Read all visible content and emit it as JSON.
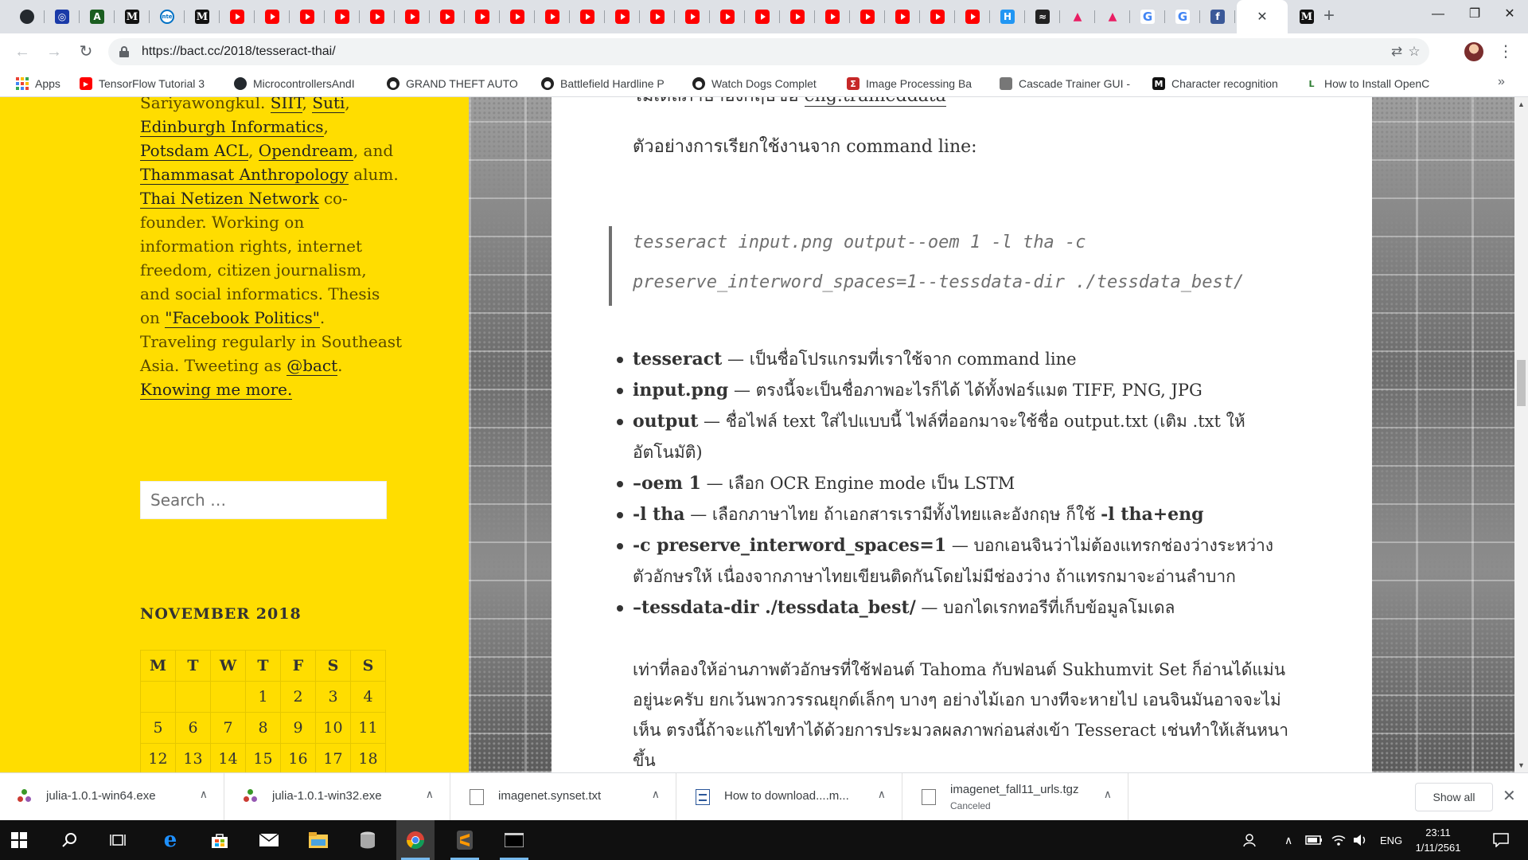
{
  "browser": {
    "tabs": [
      {
        "icon": "github-icon",
        "cls": "gh",
        "glyph": ""
      },
      {
        "icon": "blue-logo-icon",
        "cls": "blue",
        "glyph": "◎"
      },
      {
        "icon": "nvidia-icon",
        "cls": "nv",
        "glyph": "A"
      },
      {
        "icon": "medium-icon",
        "cls": "m",
        "glyph": "M"
      },
      {
        "icon": "intel-icon",
        "cls": "intel",
        "glyph": "intel"
      },
      {
        "icon": "medium-icon",
        "cls": "m",
        "glyph": "M"
      },
      {
        "icon": "youtube-icon",
        "cls": "yt",
        "glyph": ""
      },
      {
        "icon": "youtube-icon",
        "cls": "yt",
        "glyph": ""
      },
      {
        "icon": "youtube-icon",
        "cls": "yt",
        "glyph": ""
      },
      {
        "icon": "youtube-icon",
        "cls": "yt",
        "glyph": ""
      },
      {
        "icon": "youtube-icon",
        "cls": "yt",
        "glyph": ""
      },
      {
        "icon": "youtube-icon",
        "cls": "yt",
        "glyph": ""
      },
      {
        "icon": "youtube-icon",
        "cls": "yt",
        "glyph": ""
      },
      {
        "icon": "youtube-icon",
        "cls": "yt",
        "glyph": ""
      },
      {
        "icon": "youtube-icon",
        "cls": "yt",
        "glyph": ""
      },
      {
        "icon": "youtube-icon",
        "cls": "yt",
        "glyph": ""
      },
      {
        "icon": "youtube-icon",
        "cls": "yt",
        "glyph": ""
      },
      {
        "icon": "youtube-icon",
        "cls": "yt",
        "glyph": ""
      },
      {
        "icon": "youtube-icon",
        "cls": "yt",
        "glyph": ""
      },
      {
        "icon": "youtube-icon",
        "cls": "yt",
        "glyph": ""
      },
      {
        "icon": "youtube-icon",
        "cls": "yt",
        "glyph": ""
      },
      {
        "icon": "youtube-icon",
        "cls": "yt",
        "glyph": ""
      },
      {
        "icon": "youtube-icon",
        "cls": "yt",
        "glyph": ""
      },
      {
        "icon": "youtube-icon",
        "cls": "yt",
        "glyph": ""
      },
      {
        "icon": "youtube-icon",
        "cls": "yt",
        "glyph": ""
      },
      {
        "icon": "youtube-icon",
        "cls": "yt",
        "glyph": ""
      },
      {
        "icon": "youtube-icon",
        "cls": "yt",
        "glyph": ""
      },
      {
        "icon": "youtube-icon",
        "cls": "yt",
        "glyph": ""
      },
      {
        "icon": "hackernoon-icon",
        "cls": "h",
        "glyph": "H"
      },
      {
        "icon": "dark-site-icon",
        "cls": "dark",
        "glyph": "≈"
      },
      {
        "icon": "triangle-logo-icon",
        "cls": "tri",
        "glyph": "▲"
      },
      {
        "icon": "triangle-logo-icon",
        "cls": "tri",
        "glyph": "▲"
      },
      {
        "icon": "google-icon",
        "cls": "g",
        "glyph": "G"
      },
      {
        "icon": "google-icon",
        "cls": "g",
        "glyph": "G"
      },
      {
        "icon": "facebook-icon",
        "cls": "fb",
        "glyph": "f"
      }
    ],
    "active_tab_icon": "close-icon",
    "after_tab": {
      "icon": "medium-icon",
      "glyph": "M"
    },
    "url": "https://bact.cc/2018/tesseract-thai/"
  },
  "bookmarks": [
    {
      "label": "Apps",
      "icon": "apps-icon"
    },
    {
      "label": "TensorFlow Tutorial 3",
      "icon": "youtube-icon"
    },
    {
      "label": "MicrocontrollersAndI",
      "icon": "github-icon"
    },
    {
      "label": "GRAND THEFT AUTO",
      "icon": "game-icon"
    },
    {
      "label": "Battlefield Hardline P",
      "icon": "game-icon"
    },
    {
      "label": "Watch Dogs Complet",
      "icon": "game-icon"
    },
    {
      "label": "Image Processing Ba",
      "icon": "sigma-icon"
    },
    {
      "label": "Cascade Trainer GUI -",
      "icon": "app-icon"
    },
    {
      "label": "Character recognition",
      "icon": "medium-icon"
    },
    {
      "label": "How to Install OpenC",
      "icon": "l2c-icon"
    }
  ],
  "sidebar": {
    "bio_lines": [
      {
        "parts": [
          {
            "t": "Sariyawongkul. ",
            "l": false
          },
          {
            "t": "SIIT",
            "l": true
          },
          {
            "t": ", ",
            "l": false
          },
          {
            "t": "Suti",
            "l": true
          },
          {
            "t": ",",
            "l": false
          }
        ]
      },
      {
        "parts": [
          {
            "t": "Edinburgh Informatics",
            "l": true
          },
          {
            "t": ",",
            "l": false
          }
        ]
      },
      {
        "parts": [
          {
            "t": "Potsdam ACL",
            "l": true
          },
          {
            "t": ", ",
            "l": false
          },
          {
            "t": "Opendream",
            "l": true
          },
          {
            "t": ", and",
            "l": false
          }
        ]
      },
      {
        "parts": [
          {
            "t": "Thammasat Anthropology",
            "l": true
          },
          {
            "t": " alum.",
            "l": false
          }
        ]
      },
      {
        "parts": [
          {
            "t": "Thai Netizen Network",
            "l": true
          },
          {
            "t": " co-",
            "l": false
          }
        ]
      },
      {
        "parts": [
          {
            "t": "founder. Working on",
            "l": false
          }
        ]
      },
      {
        "parts": [
          {
            "t": "information rights, internet",
            "l": false
          }
        ]
      },
      {
        "parts": [
          {
            "t": "freedom, citizen journalism,",
            "l": false
          }
        ]
      },
      {
        "parts": [
          {
            "t": "and social informatics. Thesis",
            "l": false
          }
        ]
      },
      {
        "parts": [
          {
            "t": "on ",
            "l": false
          },
          {
            "t": "\"Facebook Politics\"",
            "l": true
          },
          {
            "t": ".",
            "l": false
          }
        ]
      },
      {
        "parts": [
          {
            "t": "Traveling regularly in Southeast",
            "l": false
          }
        ]
      },
      {
        "parts": [
          {
            "t": "Asia. Tweeting as ",
            "l": false
          },
          {
            "t": "@bact",
            "l": true
          },
          {
            "t": ".",
            "l": false
          }
        ]
      },
      {
        "parts": [
          {
            "t": "Knowing me more.",
            "l": true
          }
        ]
      }
    ],
    "search_placeholder": "Search …",
    "calendar_title": "NOVEMBER 2018",
    "calendar_days": [
      "M",
      "T",
      "W",
      "T",
      "F",
      "S",
      "S"
    ],
    "calendar_rows": [
      [
        "",
        "",
        "",
        "1",
        "2",
        "3",
        "4"
      ],
      [
        "5",
        "6",
        "7",
        "8",
        "9",
        "10",
        "11"
      ],
      [
        "12",
        "13",
        "14",
        "15",
        "16",
        "17",
        "18"
      ]
    ]
  },
  "article": {
    "line1_prefix": "โมเดลภาษาอังกฤษชื่อ ",
    "line1_link": "eng.traineddata",
    "example_intro": "ตัวอย่างการเรียกใช้งานจาก command line:",
    "code_line1": "tesseract input.png output--oem 1 -l tha -c",
    "code_line2": "preserve_interword_spaces=1--tessdata-dir ./tessdata_best/",
    "options": [
      {
        "term": "tesseract",
        "desc": " — เป็นชื่อโปรแกรมที่เราใช้จาก command line"
      },
      {
        "term": "input.png",
        "desc": " — ตรงนี้จะเป็นชื่อภาพอะไรก็ได้ ได้ทั้งฟอร์แมต TIFF, PNG, JPG"
      },
      {
        "term": "output",
        "desc": " — ชื่อไฟล์ text ใส่ไปแบบนี้ ไฟล์ที่ออกมาจะใช้ชื่อ output.txt (เติม .txt ให้อัตโนมัติ)"
      },
      {
        "term": "–oem 1",
        "desc": " — เลือก OCR Engine mode เป็น LSTM"
      },
      {
        "term": "-l tha",
        "desc": " — เลือกภาษาไทย ถ้าเอกสารเรามีทั้งไทยและอังกฤษ ก็ใช้ ",
        "term2": "-l tha+eng"
      },
      {
        "term": "-c preserve_interword_spaces=1",
        "desc": " — บอกเอนจินว่าไม่ต้องแทรกช่องว่างระหว่างตัวอักษรให้ เนื่องจากภาษาไทยเขียนติดกันโดยไม่มีช่องว่าง ถ้าแทรกมาจะอ่านลำบาก"
      },
      {
        "term": "–tessdata-dir ./tessdata_best/",
        "desc": " — บอกไดเรกทอรีที่เก็บข้อมูลโมเดล"
      }
    ],
    "closing_paragraph": "เท่าที่ลองให้อ่านภาพตัวอักษรที่ใช้ฟอนต์ Tahoma กับฟอนต์ Sukhumvit Set ก็อ่านได้แม่นอยู่นะครับ ยกเว้นพวกวรรณยุกต์เล็กๆ บางๆ อย่างไม้เอก บางทีจะหายไป เอนจินมันอาจจะไม่เห็น ตรงนี้ถ้าจะแก้ไขทำได้ด้วยการประมวลผลภาพก่อนส่งเข้า Tesseract เช่นทำให้เส้นหนาขึ้น"
  },
  "downloads": [
    {
      "name": "julia-1.0.1-win64.exe",
      "status": "",
      "icon": "julia-icon"
    },
    {
      "name": "julia-1.0.1-win32.exe",
      "status": "",
      "icon": "julia-icon"
    },
    {
      "name": "imagenet.synset.txt",
      "status": "",
      "icon": "text-file-icon"
    },
    {
      "name": "How to download....m...",
      "status": "",
      "icon": "doc-file-icon"
    },
    {
      "name": "imagenet_fall11_urls.tgz",
      "status": "Canceled",
      "icon": "file-icon"
    }
  ],
  "downloads_show_all": "Show all",
  "taskbar": {
    "language": "ENG",
    "time": "23:11",
    "date": "1/11/2561"
  },
  "colors": {
    "sidebar_yellow": "#ffdd00",
    "youtube_red": "#ff0000",
    "taskbar": "#101010"
  }
}
